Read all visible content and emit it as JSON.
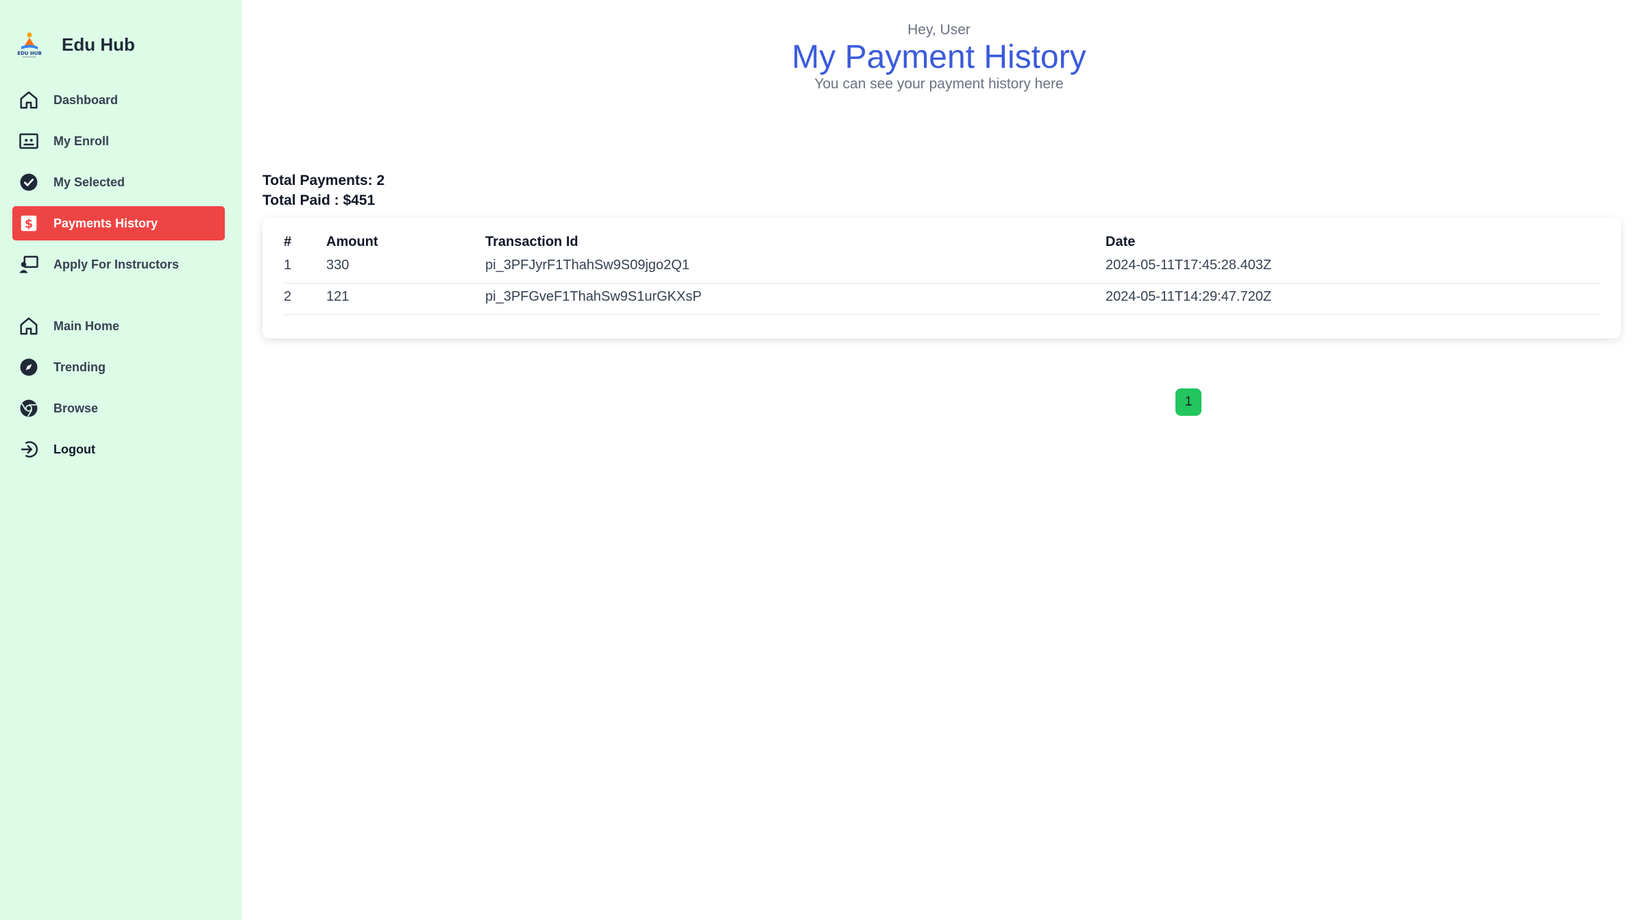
{
  "brand": {
    "name": "Edu Hub",
    "logo_text": "EDU HUB"
  },
  "sidebar": {
    "items": [
      {
        "label": "Dashboard",
        "icon": "home-icon"
      },
      {
        "label": "My Enroll",
        "icon": "enroll-icon"
      },
      {
        "label": "My Selected",
        "icon": "check-circle-icon"
      },
      {
        "label": "Payments History",
        "icon": "dollar-icon",
        "active": true
      },
      {
        "label": "Apply For Instructors",
        "icon": "instructor-icon"
      },
      {
        "label": "Main Home",
        "icon": "home-icon"
      },
      {
        "label": "Trending",
        "icon": "compass-icon"
      },
      {
        "label": "Browse",
        "icon": "browser-icon"
      },
      {
        "label": "Logout",
        "icon": "logout-icon"
      }
    ]
  },
  "header": {
    "greeting": "Hey, User",
    "title": "My Payment History",
    "subtitle": "You can see your payment history here"
  },
  "summary": {
    "total_payments": "Total Payments: 2",
    "total_paid": "Total Paid : $451"
  },
  "table": {
    "headers": [
      "#",
      "Amount",
      "Transaction Id",
      "Date"
    ],
    "rows": [
      [
        "1",
        "330",
        "pi_3PFJyrF1ThahSw9S09jgo2Q1",
        "2024-05-11T17:45:28.403Z"
      ],
      [
        "2",
        "121",
        "pi_3PFGveF1ThahSw9S1urGKXsP",
        "2024-05-11T14:29:47.720Z"
      ]
    ]
  },
  "pagination": {
    "current": "1"
  },
  "colors": {
    "sidebar_bg": "#dcfce7",
    "active_item": "#ef4444",
    "title": "#3b5bdb",
    "page_button": "#22c55e"
  }
}
